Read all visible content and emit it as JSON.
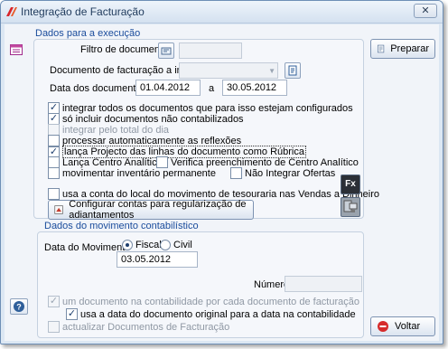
{
  "window": {
    "title": "Integração de Facturação",
    "close_symbol": "✕"
  },
  "execution": {
    "section_label": "Dados para a execução",
    "filtro_label": "Filtro de documentos",
    "doc_label": "Documento de facturação a integrar",
    "date_label": "Data dos documentos",
    "date_from": "01.04.2012",
    "date_sep": "a",
    "date_to": "30.05.2012",
    "options": [
      {
        "label": "integrar todos os documentos que para isso estejam configurados",
        "checked": true
      },
      {
        "label": "só incluir documentos não contabilizados",
        "checked": true
      },
      {
        "label": "integrar pelo total do dia",
        "checked": false
      },
      {
        "label": "processar automaticamente as reflexões",
        "checked": false
      },
      {
        "label": "lança Projecto das linhas do documento como Rúbrica",
        "checked": true
      },
      {
        "label": "Lança Centro Analítico",
        "checked": false
      },
      {
        "label": "Verifica preenchimento de Centro Analítico",
        "checked": false
      },
      {
        "label": "movimentar inventário permanente",
        "checked": false
      },
      {
        "label": "Não Integrar Ofertas",
        "checked": false
      },
      {
        "label": "usa a conta do local do movimento de tesouraria nas Vendas a Dinheiro",
        "checked": false
      }
    ],
    "config_button": "Configurar contas para regularização de adiantamentos",
    "fx_button": "Fx"
  },
  "movement": {
    "section_label": "Dados do movimento contabilístico",
    "date_label": "Data do Movimento",
    "radio_fiscal": "Fiscal",
    "radio_civil": "Civil",
    "date_value": "03.05.2012",
    "numero_label": "Número",
    "opt_one_doc": "um documento na contabilidade por cada documento de facturação",
    "opt_use_date": "usa a data do documento original para a data na contabilidade",
    "opt_update_docs": "actualizar Documentos de Facturação"
  },
  "actions": {
    "preparar": "Preparar",
    "voltar": "Voltar"
  },
  "icons": {
    "app": "app-logo-icon",
    "layout": "layout-icon",
    "help": "help-icon"
  }
}
